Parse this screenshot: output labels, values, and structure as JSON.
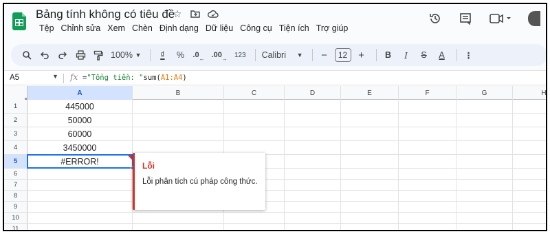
{
  "app": {
    "title": "Bảng tính không có tiêu đề",
    "accent": "#0f9d58"
  },
  "menu": [
    "Tệp",
    "Chỉnh sửa",
    "Xem",
    "Chèn",
    "Định dạng",
    "Dữ liệu",
    "Công cụ",
    "Tiện ích",
    "Trợ giúp"
  ],
  "toolbar": {
    "zoom": "100%",
    "currency": "₫",
    "percent": "%",
    "decrease_decimal": ".0",
    "increase_decimal": ".00",
    "number_format": "123",
    "font": "Calibri",
    "font_size": "12",
    "minus": "−",
    "plus": "+",
    "bold": "B",
    "italic": "I",
    "strikethrough": "S",
    "text_color": "A",
    "more": "⋮"
  },
  "formula_bar": {
    "name_box": "A5",
    "fx": "fx",
    "formula_prefix": "=",
    "formula_string": "\"Tổng tiền: \"",
    "formula_func": "sum(",
    "formula_ref": "A1:A4",
    "formula_close": ")"
  },
  "columns": [
    "A",
    "B",
    "C",
    "D",
    "E",
    "F",
    "G",
    "H"
  ],
  "selected_column": "A",
  "rows": [
    {
      "num": "1",
      "a": "445000"
    },
    {
      "num": "2",
      "a": "50000"
    },
    {
      "num": "3",
      "a": "60000"
    },
    {
      "num": "4",
      "a": "3450000"
    },
    {
      "num": "5",
      "a": "#ERROR!"
    },
    {
      "num": "6",
      "a": ""
    },
    {
      "num": "7",
      "a": ""
    },
    {
      "num": "8",
      "a": ""
    },
    {
      "num": "9",
      "a": ""
    },
    {
      "num": "10",
      "a": ""
    },
    {
      "num": "11",
      "a": ""
    }
  ],
  "selected_row": "5",
  "error_popup": {
    "title": "Lỗi",
    "message": "Lỗi phân tích cú pháp công thức.",
    "color": "#d93025"
  }
}
